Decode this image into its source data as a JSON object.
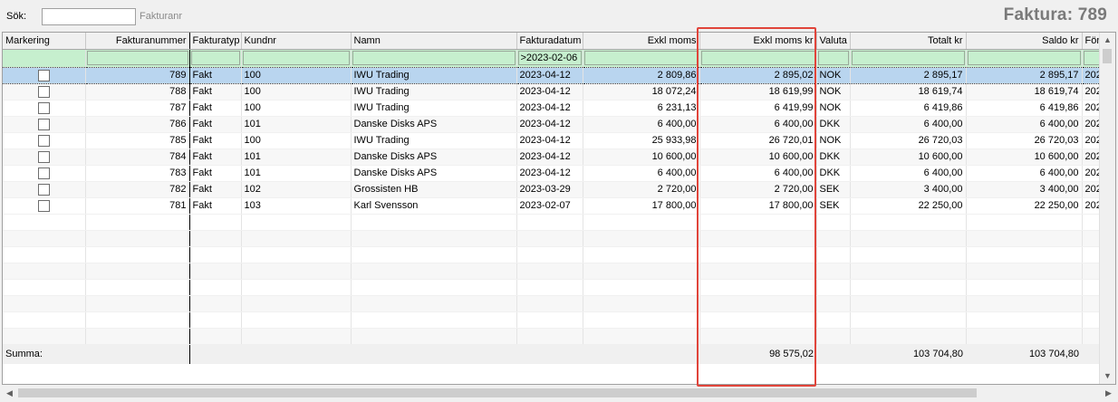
{
  "toolbar": {
    "search_label": "Sök:",
    "search_value": "",
    "search_hint": "Fakturanr",
    "title": "Faktura: 789"
  },
  "grid": {
    "columns": [
      "Markering",
      "Fakturanummer",
      "Fakturatyp",
      "Kundnr",
      "Namn",
      "Fakturadatum",
      "Exkl moms",
      "Exkl moms kr",
      "Valuta",
      "Totalt kr",
      "Saldo kr",
      "Förf"
    ],
    "filter": {
      "fakturadatum": ">2023-02-06"
    },
    "rows": [
      {
        "nr": "789",
        "typ": "Fakt",
        "kund": "100",
        "namn": "IWU Trading",
        "datum": "2023-04-12",
        "exkl": "2 809,86",
        "exklkr": "2 895,02",
        "valuta": "NOK",
        "totalt": "2 895,17",
        "saldo": "2 895,17",
        "forf": "202"
      },
      {
        "nr": "788",
        "typ": "Fakt",
        "kund": "100",
        "namn": "IWU Trading",
        "datum": "2023-04-12",
        "exkl": "18 072,24",
        "exklkr": "18 619,99",
        "valuta": "NOK",
        "totalt": "18 619,74",
        "saldo": "18 619,74",
        "forf": "202"
      },
      {
        "nr": "787",
        "typ": "Fakt",
        "kund": "100",
        "namn": "IWU Trading",
        "datum": "2023-04-12",
        "exkl": "6 231,13",
        "exklkr": "6 419,99",
        "valuta": "NOK",
        "totalt": "6 419,86",
        "saldo": "6 419,86",
        "forf": "202"
      },
      {
        "nr": "786",
        "typ": "Fakt",
        "kund": "101",
        "namn": "Danske Disks APS",
        "datum": "2023-04-12",
        "exkl": "6 400,00",
        "exklkr": "6 400,00",
        "valuta": "DKK",
        "totalt": "6 400,00",
        "saldo": "6 400,00",
        "forf": "202"
      },
      {
        "nr": "785",
        "typ": "Fakt",
        "kund": "100",
        "namn": "IWU Trading",
        "datum": "2023-04-12",
        "exkl": "25 933,98",
        "exklkr": "26 720,01",
        "valuta": "NOK",
        "totalt": "26 720,03",
        "saldo": "26 720,03",
        "forf": "202"
      },
      {
        "nr": "784",
        "typ": "Fakt",
        "kund": "101",
        "namn": "Danske Disks APS",
        "datum": "2023-04-12",
        "exkl": "10 600,00",
        "exklkr": "10 600,00",
        "valuta": "DKK",
        "totalt": "10 600,00",
        "saldo": "10 600,00",
        "forf": "202"
      },
      {
        "nr": "783",
        "typ": "Fakt",
        "kund": "101",
        "namn": "Danske Disks APS",
        "datum": "2023-04-12",
        "exkl": "6 400,00",
        "exklkr": "6 400,00",
        "valuta": "DKK",
        "totalt": "6 400,00",
        "saldo": "6 400,00",
        "forf": "202"
      },
      {
        "nr": "782",
        "typ": "Fakt",
        "kund": "102",
        "namn": "Grossisten HB",
        "datum": "2023-03-29",
        "exkl": "2 720,00",
        "exklkr": "2 720,00",
        "valuta": "SEK",
        "totalt": "3 400,00",
        "saldo": "3 400,00",
        "forf": "202"
      },
      {
        "nr": "781",
        "typ": "Fakt",
        "kund": "103",
        "namn": "Karl Svensson",
        "datum": "2023-02-07",
        "exkl": "17 800,00",
        "exklkr": "17 800,00",
        "valuta": "SEK",
        "totalt": "22 250,00",
        "saldo": "22 250,00",
        "forf": "202"
      }
    ],
    "summary": {
      "label": "Summa:",
      "exklkr": "98 575,02",
      "totalt": "103 704,80",
      "saldo": "103 704,80"
    }
  },
  "colors": {
    "highlight": "#e0443a",
    "filter_bg": "#c6efce",
    "selected_row": "#b9d5ef"
  }
}
